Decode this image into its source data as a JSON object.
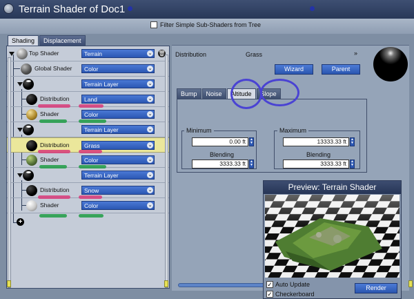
{
  "window": {
    "title": "Terrain Shader of Doc1"
  },
  "filter": {
    "label": "Filter Simple Sub-Shaders from Tree",
    "checked": false
  },
  "tree_tabs": [
    {
      "label": "Shading",
      "active": true
    },
    {
      "label": "Displacement",
      "active": false
    }
  ],
  "tree": {
    "rows": [
      {
        "label": "Top Shader",
        "value": "Terrain",
        "sphere": "grey"
      },
      {
        "label": "Global Shader",
        "value": "Color",
        "sphere": "grey"
      },
      {
        "label": "",
        "value": "Terrain Layer",
        "sphere": "black"
      },
      {
        "label": "Distribution",
        "value": "Land",
        "sphere": "dark"
      },
      {
        "label": "Shader",
        "value": "Color",
        "sphere": "gold"
      },
      {
        "label": "",
        "value": "Terrain Layer",
        "sphere": "black"
      },
      {
        "label": "Distribution",
        "value": "Grass",
        "sphere": "dark",
        "highlighted": true
      },
      {
        "label": "Shader",
        "value": "Color",
        "sphere": "green"
      },
      {
        "label": "",
        "value": "Terrain Layer",
        "sphere": "black"
      },
      {
        "label": "Distribution",
        "value": "Snow",
        "sphere": "dark"
      },
      {
        "label": "Shader",
        "value": "Color",
        "sphere": "white"
      }
    ]
  },
  "panel": {
    "field_label": "Distribution",
    "field_value": "Grass",
    "wizard_label": "Wizard",
    "parent_label": "Parent",
    "tabs": [
      {
        "label": "Bump",
        "active": false
      },
      {
        "label": "Noise",
        "active": false
      },
      {
        "label": "Altitude",
        "active": true
      },
      {
        "label": "Slope",
        "active": false
      }
    ],
    "minimum": {
      "label": "Minimum",
      "value": "0.00 ft",
      "blending_label": "Blending",
      "blending_value": "3333.33 ft"
    },
    "maximum": {
      "label": "Maximum",
      "value": "13333.33 ft",
      "blending_label": "Blending",
      "blending_value": "3333.33 ft"
    }
  },
  "preview": {
    "title": "Preview: Terrain Shader",
    "auto_update_label": "Auto Update",
    "auto_update_checked": true,
    "checkerboard_label": "Checkerboard",
    "checkerboard_checked": true,
    "render_label": "Render"
  },
  "colors": {
    "accent_blue": "#2b57b3",
    "highlight_row": "#ebe79b",
    "annotation_circle": "#4a43d3"
  }
}
